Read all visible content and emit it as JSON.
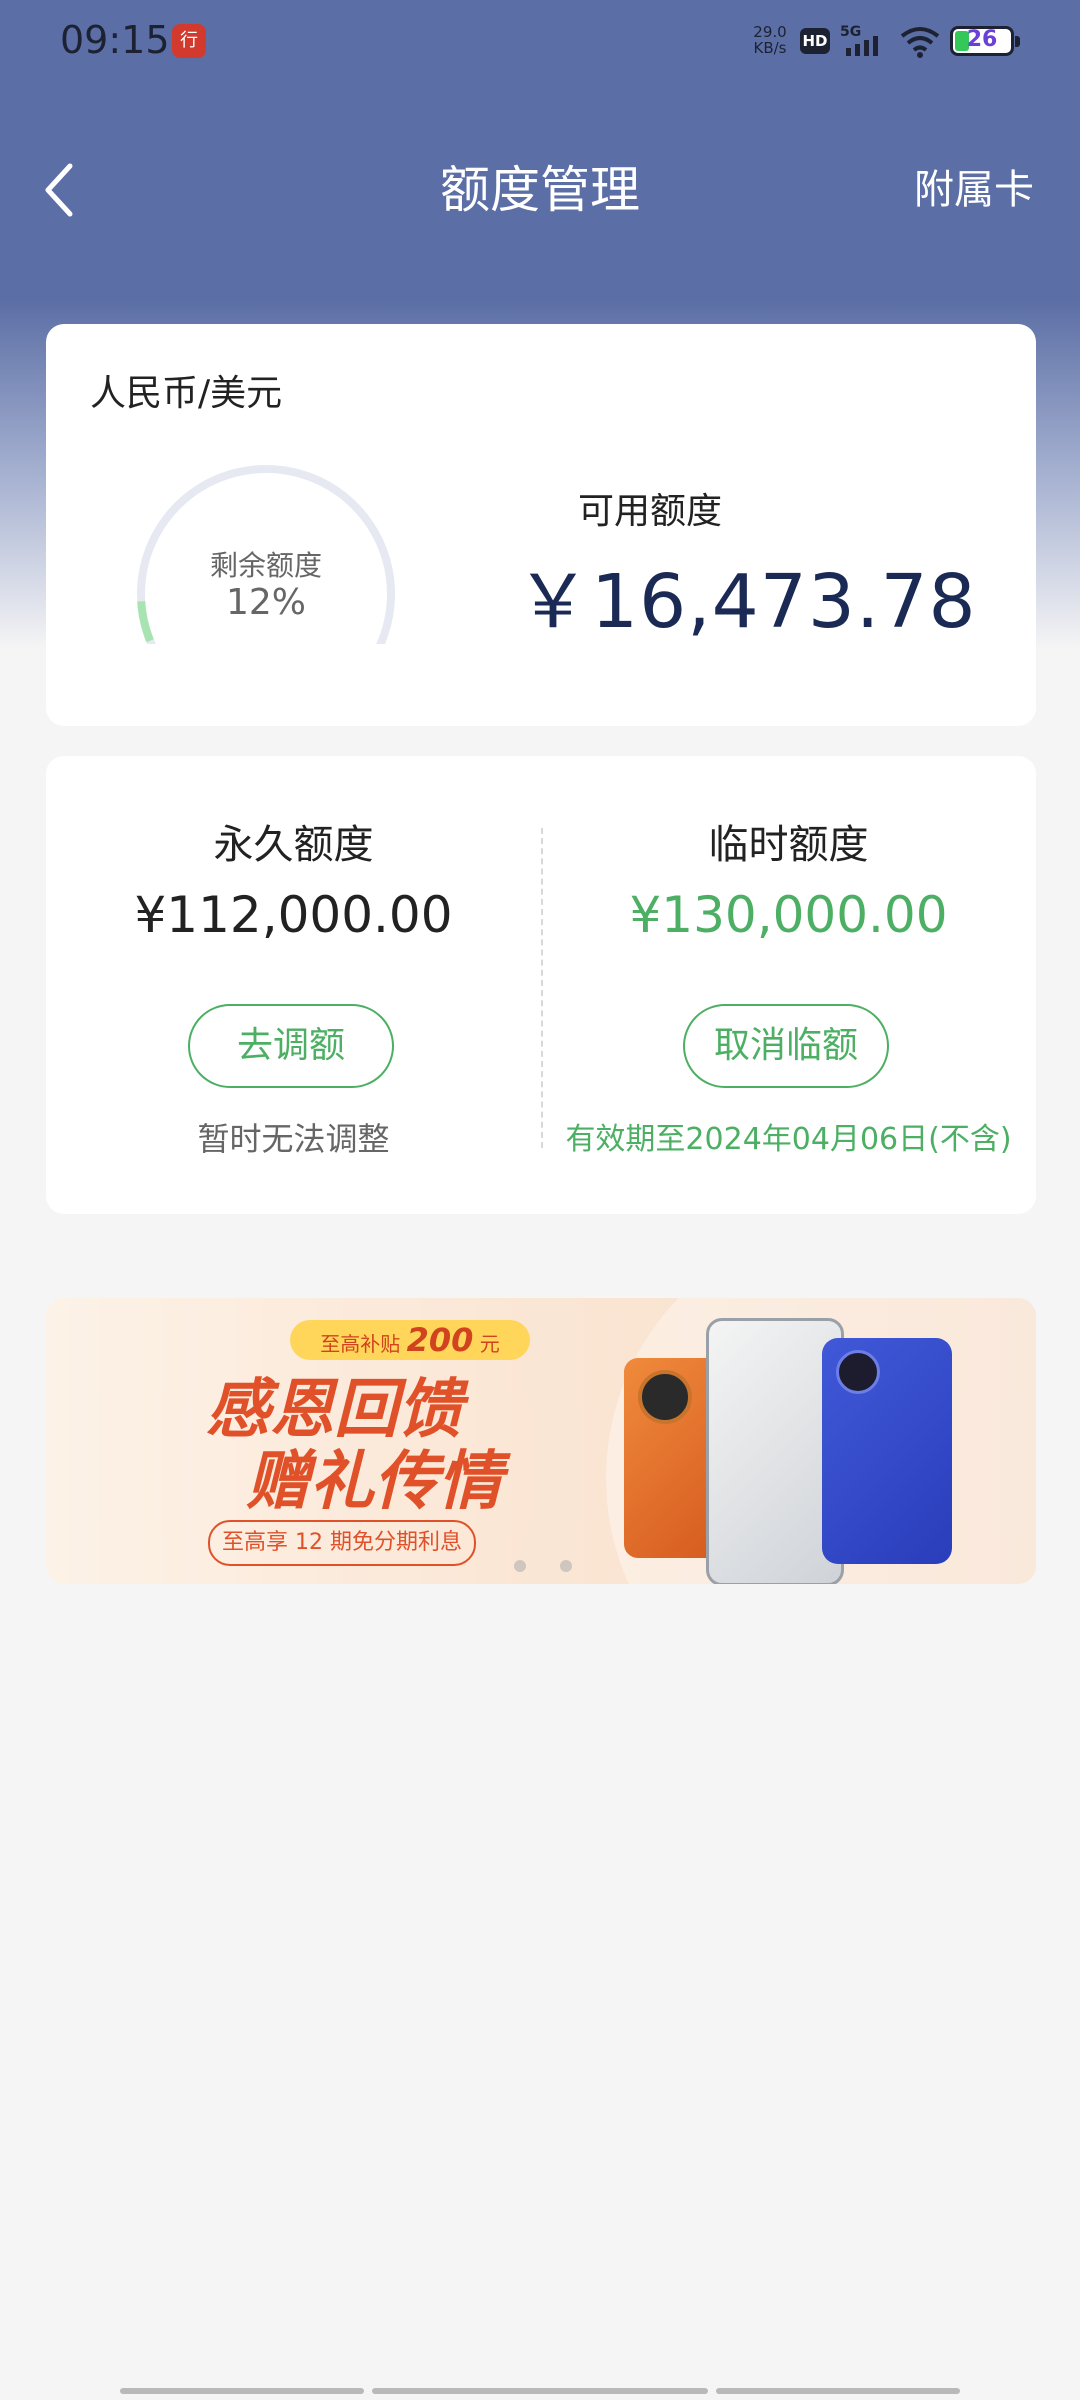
{
  "status_bar": {
    "time": "09:15",
    "app_icon": "bank-app-icon",
    "network_speed_value": "29.0",
    "network_speed_unit": "KB/s",
    "hd_label": "HD",
    "network_type": "5G",
    "battery_level": "26",
    "battery_color": "#34c759"
  },
  "nav": {
    "back_icon": "chevron-left-icon",
    "title": "额度管理",
    "right_label": "附属卡"
  },
  "available_card": {
    "currency": "人民币/美元",
    "gauge_label": "剩余额度",
    "gauge_percent_text": "12%",
    "gauge_fraction": 0.12,
    "available_title": "可用额度",
    "available_amount": "￥16,473.78"
  },
  "limits_card": {
    "permanent": {
      "title": "永久额度",
      "amount": "¥112,000.00",
      "button_label": "去调额",
      "note": "暂时无法调整"
    },
    "temporary": {
      "title": "临时额度",
      "amount": "¥130,000.00",
      "button_label": "取消临额",
      "note": "有效期至2024年04月06日(不含)"
    }
  },
  "banner": {
    "tag_prefix": "至高补贴",
    "tag_amount": "200",
    "tag_suffix": "元",
    "headline_1": "感恩回馈",
    "headline_2": "赠礼传情",
    "pill": "至高享 12 期免分期利息",
    "page_count": 2,
    "active_page": 1
  },
  "colors": {
    "header_bg": "#5b6ea5",
    "accent_green": "#4caf63",
    "amount_navy": "#1a2a54"
  }
}
